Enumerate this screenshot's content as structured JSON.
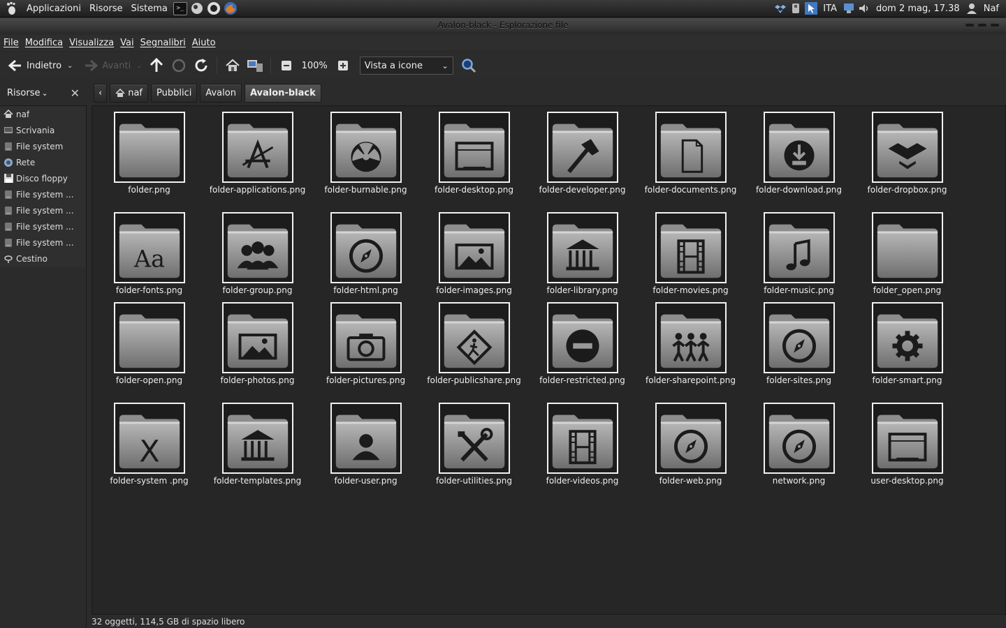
{
  "panel": {
    "menus": [
      "Applicazioni",
      "Risorse",
      "Sistema"
    ],
    "keyboard": "ITA",
    "clock": "dom  2 mag, 17.38",
    "user": "Naf"
  },
  "window": {
    "title": "Avalon-black - Esplorazione file"
  },
  "menubar": [
    "File",
    "Modifica",
    "Visualizza",
    "Vai",
    "Segnalibri",
    "Aiuto"
  ],
  "toolbar": {
    "back_label": "Indietro",
    "forward_label": "Avanti",
    "zoom": "100%",
    "view_mode": "Vista a icone"
  },
  "sidebar": {
    "title": "Risorse",
    "items": [
      {
        "label": "naf",
        "icon": "home-icon"
      },
      {
        "label": "Scrivania",
        "icon": "desktop-icon"
      },
      {
        "label": "File system",
        "icon": "drive-icon"
      },
      {
        "label": "Rete",
        "icon": "network-icon"
      },
      {
        "label": "Disco floppy",
        "icon": "floppy-icon"
      },
      {
        "label": "File system ...",
        "icon": "drive-icon"
      },
      {
        "label": "File system ...",
        "icon": "drive-icon"
      },
      {
        "label": "File system ...",
        "icon": "drive-icon"
      },
      {
        "label": "File system ...",
        "icon": "drive-icon"
      },
      {
        "label": "Cestino",
        "icon": "trash-icon"
      }
    ]
  },
  "pathbar": [
    "naf",
    "Pubblici",
    "Avalon",
    "Avalon-black"
  ],
  "files": [
    {
      "name": "folder.png",
      "glyph": "blank"
    },
    {
      "name": "folder-applications.png",
      "glyph": "apps"
    },
    {
      "name": "folder-burnable.png",
      "glyph": "burn"
    },
    {
      "name": "folder-desktop.png",
      "glyph": "desktop"
    },
    {
      "name": "folder-developer.png",
      "glyph": "hammer"
    },
    {
      "name": "folder-documents.png",
      "glyph": "doc"
    },
    {
      "name": "folder-download.png",
      "glyph": "download"
    },
    {
      "name": "folder-dropbox.png",
      "glyph": "dropbox"
    },
    {
      "name": "folder-fonts.png",
      "glyph": "fonts"
    },
    {
      "name": "folder-group.png",
      "glyph": "group"
    },
    {
      "name": "folder-html.png",
      "glyph": "compass"
    },
    {
      "name": "folder-images.png",
      "glyph": "image"
    },
    {
      "name": "folder-library.png",
      "glyph": "library"
    },
    {
      "name": "folder-movies.png",
      "glyph": "film"
    },
    {
      "name": "folder-music.png",
      "glyph": "music"
    },
    {
      "name": "folder_open.png",
      "glyph": "blank"
    },
    {
      "name": "folder-open.png",
      "glyph": "blank"
    },
    {
      "name": "folder-photos.png",
      "glyph": "image"
    },
    {
      "name": "folder-pictures.png",
      "glyph": "camera"
    },
    {
      "name": "folder-publicshare.png",
      "glyph": "publicshare"
    },
    {
      "name": "folder-restricted.png",
      "glyph": "restricted"
    },
    {
      "name": "folder-sharepoint.png",
      "glyph": "sharepoint"
    },
    {
      "name": "folder-sites.png",
      "glyph": "compass"
    },
    {
      "name": "folder-smart.png",
      "glyph": "gear"
    },
    {
      "name": "folder-system .png",
      "glyph": "system"
    },
    {
      "name": "folder-templates.png",
      "glyph": "library"
    },
    {
      "name": "folder-user.png",
      "glyph": "user"
    },
    {
      "name": "folder-utilities.png",
      "glyph": "tools"
    },
    {
      "name": "folder-videos.png",
      "glyph": "film"
    },
    {
      "name": "folder-web.png",
      "glyph": "compass"
    },
    {
      "name": "network.png",
      "glyph": "compass"
    },
    {
      "name": "user-desktop.png",
      "glyph": "desktop"
    }
  ],
  "status": "32 oggetti, 114,5 GB di spazio libero"
}
